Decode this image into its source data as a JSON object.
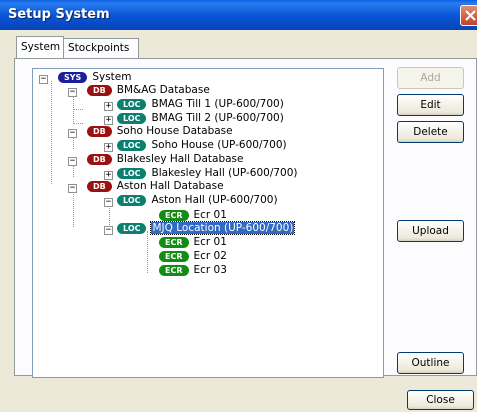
{
  "window": {
    "title": "Setup System"
  },
  "tabs": [
    {
      "label": "System"
    },
    {
      "label": "Stockpoints"
    }
  ],
  "tree": {
    "root": {
      "badge": "SYS",
      "label": "System"
    },
    "db1": {
      "badge": "DB",
      "label": "BM&AG Database"
    },
    "db1_loc1": {
      "badge": "LOC",
      "label": "BMAG Till 1 (UP-600/700)"
    },
    "db1_loc2": {
      "badge": "LOC",
      "label": "BMAG Till 2 (UP-600/700)"
    },
    "db2": {
      "badge": "DB",
      "label": "Soho House Database"
    },
    "db2_loc1": {
      "badge": "LOC",
      "label": "Soho House (UP-600/700)"
    },
    "db3": {
      "badge": "DB",
      "label": "Blakesley Hall Database"
    },
    "db3_loc1": {
      "badge": "LOC",
      "label": "Blakesley Hall (UP-600/700)"
    },
    "db4": {
      "badge": "DB",
      "label": "Aston Hall Database"
    },
    "db4_loc1": {
      "badge": "LOC",
      "label": "Aston Hall (UP-600/700)"
    },
    "db4_loc1_ecr1": {
      "badge": "ECR",
      "label": "Ecr 01"
    },
    "db4_loc2": {
      "badge": "LOC",
      "label": "MJQ Location (UP-600/700)"
    },
    "db4_loc2_ecr1": {
      "badge": "ECR",
      "label": "Ecr 01"
    },
    "db4_loc2_ecr2": {
      "badge": "ECR",
      "label": "Ecr 02"
    },
    "db4_loc2_ecr3": {
      "badge": "ECR",
      "label": "Ecr 03"
    }
  },
  "buttons": {
    "add": "Add",
    "edit": "Edit",
    "delete": "Delete",
    "upload": "Upload",
    "outline": "Outline",
    "close": "Close"
  },
  "colors": {
    "sys": "#1b1f9a",
    "db": "#9b1010",
    "loc": "#0b8070",
    "ecr": "#138c14",
    "selection": "#316ac5"
  }
}
